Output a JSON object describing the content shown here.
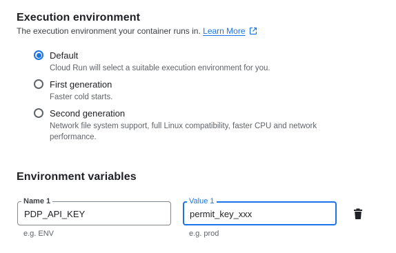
{
  "execution": {
    "title": "Execution environment",
    "description": "The execution environment your container runs in.",
    "learn_more": "Learn More",
    "options": [
      {
        "label": "Default",
        "description": "Cloud Run will select a suitable execution environment for you.",
        "selected": true
      },
      {
        "label": "First generation",
        "description": "Faster cold starts.",
        "selected": false
      },
      {
        "label": "Second generation",
        "description_line1": "Network file system support, full Linux compatibility, faster CPU and network",
        "description_line2": "performance.",
        "selected": false
      }
    ]
  },
  "env_vars": {
    "title": "Environment variables",
    "name_field": {
      "label": "Name 1",
      "value": "PDP_API_KEY",
      "hint": "e.g. ENV"
    },
    "value_field": {
      "label": "Value 1",
      "value": "permit_key_xxx",
      "hint": "e.g. prod"
    },
    "delete_icon": "trash-icon"
  },
  "colors": {
    "accent": "#1a73e8",
    "text": "#202124",
    "muted": "#5f6368"
  }
}
